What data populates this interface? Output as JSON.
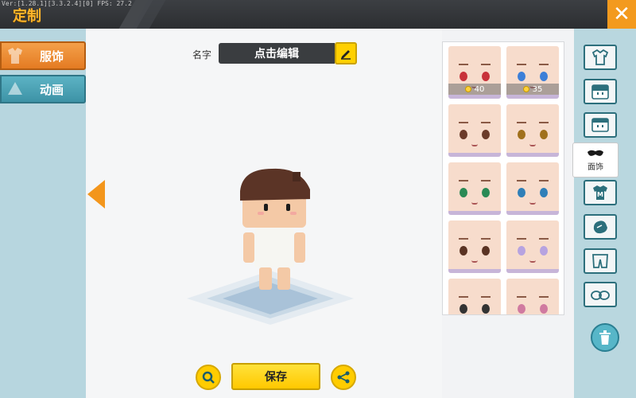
{
  "header": {
    "version_text": "Ver:[1.28.1][3.3.2.4][0] FPS: 27.2",
    "title": "定制",
    "close_symbol": "✕",
    "close_icon": "close-icon"
  },
  "categories": [
    {
      "label": "服饰",
      "icon": "clothes-category-icon",
      "active": true
    },
    {
      "label": "动画",
      "icon": "animation-category-icon",
      "active": false
    }
  ],
  "name_field": {
    "label": "名字",
    "value": "点击编辑",
    "edit_icon": "pencil-icon"
  },
  "bottom_bar": {
    "zoom_icon": "magnifier-icon",
    "save_label": "保存",
    "share_icon": "share-icon"
  },
  "faces": [
    {
      "price": "40",
      "eye_color": "#c8323a"
    },
    {
      "price": "35",
      "eye_color": "#3c7fd8"
    },
    {
      "price": "",
      "eye_color": "#6b3b2a"
    },
    {
      "price": "",
      "eye_color": "#a0701c"
    },
    {
      "price": "",
      "eye_color": "#2a8a55"
    },
    {
      "price": "",
      "eye_color": "#2f7fb8"
    },
    {
      "price": "",
      "eye_color": "#5a3323"
    },
    {
      "price": "",
      "eye_color": "#b7a3e0"
    },
    {
      "price": "",
      "eye_color": "#333333"
    },
    {
      "price": "",
      "eye_color": "#d07aa0"
    }
  ],
  "parts": [
    {
      "icon": "shirt-outline-icon"
    },
    {
      "icon": "hair-icon"
    },
    {
      "icon": "face-icon"
    },
    {
      "icon": "mask-icon",
      "label": "面饰",
      "active": true
    },
    {
      "icon": "tshirt-m-icon"
    },
    {
      "icon": "glove-icon"
    },
    {
      "icon": "pants-icon"
    },
    {
      "icon": "shoes-icon"
    }
  ],
  "trash_icon": "trash-icon",
  "colors": {
    "accent_orange": "#f3961c",
    "tab_active": "#e88a2e",
    "tab_inactive": "#4aa3b6",
    "save_yellow": "#ffd000"
  }
}
